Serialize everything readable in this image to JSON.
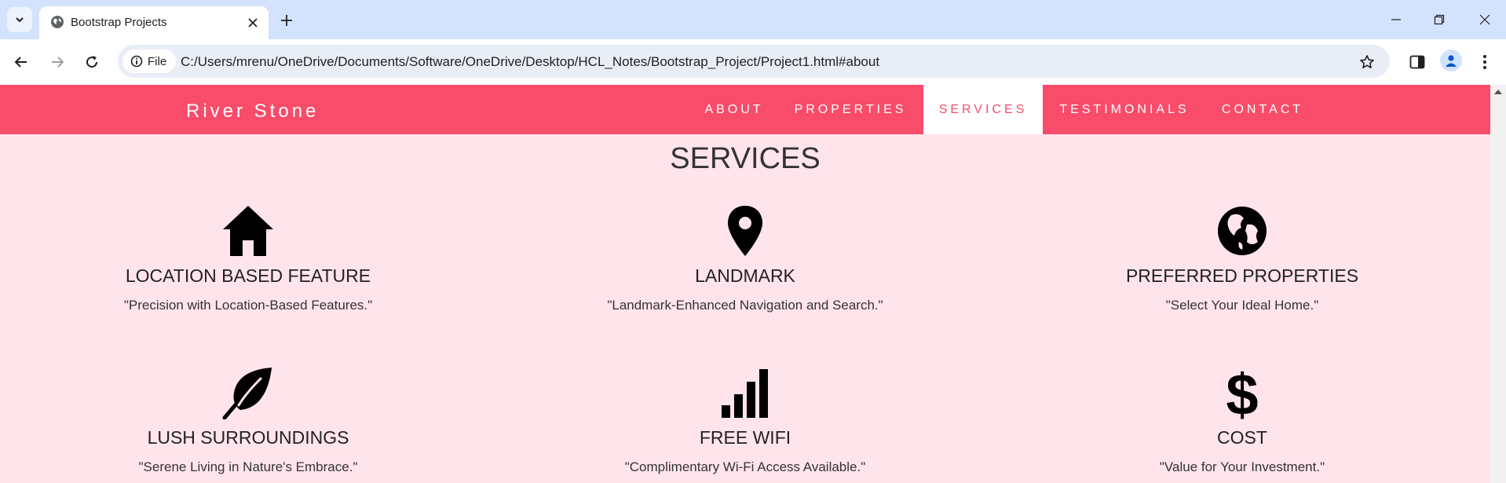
{
  "browser": {
    "tab_title": "Bootstrap Projects",
    "site_chip": "File",
    "url": "C:/Users/mrenu/OneDrive/Documents/Software/OneDrive/Desktop/HCL_Notes/Bootstrap_Project/Project1.html#about"
  },
  "site": {
    "brand": "River Stone",
    "nav": [
      "ABOUT",
      "PROPERTIES",
      "SERVICES",
      "TESTIMONIALS",
      "CONTACT"
    ],
    "active_nav": "SERVICES",
    "accent_color": "#f84c6a",
    "background_color": "#ffe4ec"
  },
  "services": {
    "title": "SERVICES",
    "items": [
      {
        "icon": "home-icon",
        "title": "LOCATION BASED FEATURE",
        "desc": "\"Precision with Location-Based Features.\""
      },
      {
        "icon": "map-pin-icon",
        "title": "LANDMARK",
        "desc": "\"Landmark-Enhanced Navigation and Search.\""
      },
      {
        "icon": "globe-icon",
        "title": "PREFERRED PROPERTIES",
        "desc": "\"Select Your Ideal Home.\""
      },
      {
        "icon": "leaf-icon",
        "title": "LUSH SURROUNDINGS",
        "desc": "\"Serene Living in Nature's Embrace.\""
      },
      {
        "icon": "signal-icon",
        "title": "FREE WIFI",
        "desc": "\"Complimentary Wi-Fi Access Available.\""
      },
      {
        "icon": "dollar-icon",
        "title": "COST",
        "desc": "\"Value for Your Investment.\""
      }
    ]
  }
}
